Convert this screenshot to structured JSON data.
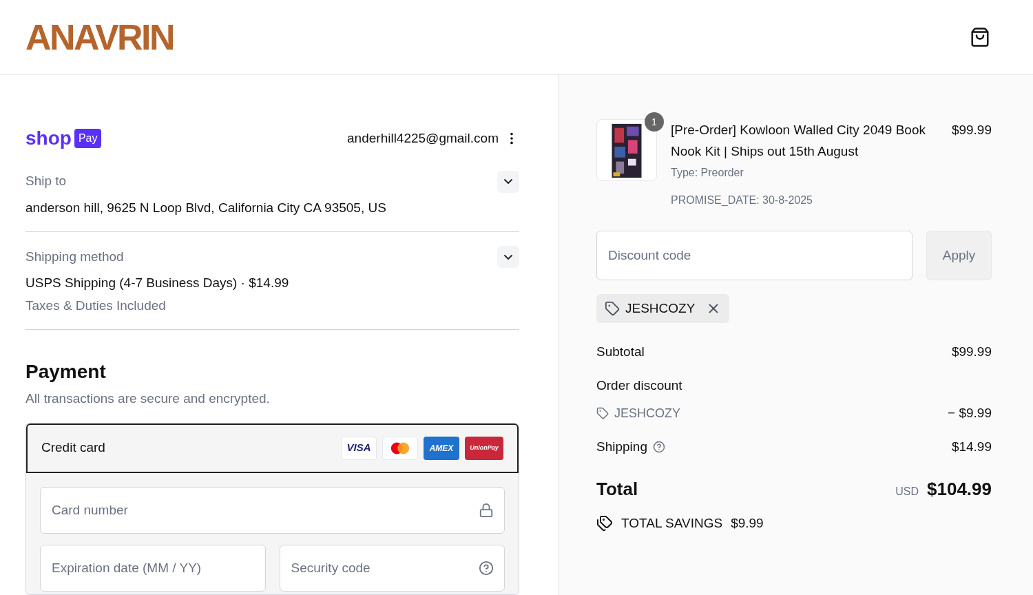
{
  "header": {
    "logo": "ANAVRIN"
  },
  "express": {
    "brand": "shop",
    "badge": "Pay",
    "email": "anderhill4225@gmail.com"
  },
  "sections": [
    {
      "label": "Ship to",
      "lines": [
        {
          "text": "anderson hill, 9625 N Loop Blvd, California City CA 93505, US",
          "muted": false
        }
      ],
      "expanded": false
    },
    {
      "label": "Shipping method",
      "lines": [
        {
          "text": "USPS Shipping (4-7 Business Days) · $14.99",
          "muted": false
        },
        {
          "text": "Taxes & Duties Included",
          "muted": true
        }
      ],
      "expanded": false
    }
  ],
  "payment": {
    "title": "Payment",
    "subtitle": "All transactions are secure and encrypted.",
    "method": {
      "label": "Credit card",
      "selected": true,
      "cards": [
        {
          "kind": "visa",
          "text": "VISA"
        },
        {
          "kind": "mastercard"
        },
        {
          "kind": "amex",
          "text": "AMEX"
        },
        {
          "kind": "unionpay",
          "text": "UnionPay"
        }
      ]
    },
    "fields": [
      {
        "placeholder": "Card number"
      },
      {
        "placeholder": "Expiration date (MM / YY)"
      },
      {
        "placeholder": "Security code"
      }
    ]
  },
  "summary": {
    "item": {
      "quantity": "1",
      "title": "[Pre-Order] Kowloon Walled City 2049 Book Nook Kit | Ships out 15th August",
      "price": "$99.99",
      "details": [
        "Type: Preorder",
        "PROMISE_DATE: 30-8-2025"
      ]
    },
    "discount": {
      "placeholder": "Discount code",
      "button": "Apply",
      "applied": "JESHCOZY"
    },
    "lines": [
      {
        "kind": "plain",
        "label": "Subtotal",
        "value": "$99.99"
      },
      {
        "kind": "discount",
        "label": "Order discount",
        "code": "JESHCOZY",
        "value": "− $9.99"
      },
      {
        "kind": "help",
        "label": "Shipping",
        "value": "$14.99"
      }
    ],
    "total": {
      "label": "Total",
      "currency": "USD",
      "value": "$104.99"
    },
    "savings": {
      "label": "TOTAL SAVINGS",
      "value": "$9.99"
    }
  }
}
